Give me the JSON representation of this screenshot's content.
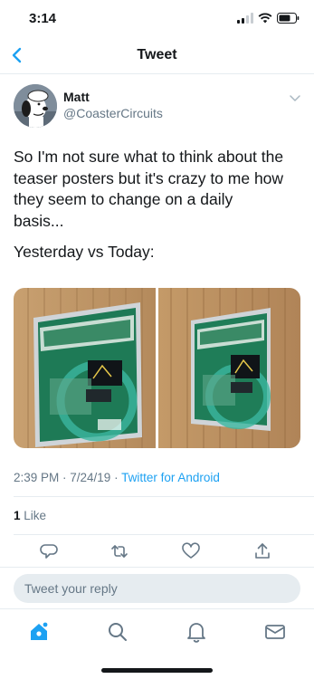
{
  "status_bar": {
    "time": "3:14",
    "icons": [
      "signal-icon",
      "wifi-icon",
      "battery-icon"
    ]
  },
  "nav": {
    "title": "Tweet",
    "back_icon": "chevron-left-icon"
  },
  "tweet": {
    "author_name": "Matt",
    "author_handle": "@CoasterCircuits",
    "text_lines": [
      "So I'm not sure what to think about the",
      "teaser posters but it's crazy to me how",
      "they seem to change on a daily",
      "basis...",
      "",
      "Yesterday vs Today:"
    ],
    "timestamp": "2:39 PM · 7/24/19 · ",
    "source": "Twitter for Android",
    "likes_count": "1",
    "likes_label": " Like"
  },
  "reply_box": {
    "placeholder": "Tweet your reply"
  },
  "tab_bar": {
    "items": [
      "home-icon",
      "search-icon",
      "notifications-icon",
      "messages-icon"
    ]
  },
  "colors": {
    "accent": "#1da1f2",
    "text": "#14171a",
    "muted": "#657786",
    "divider": "#e6ecf0"
  }
}
